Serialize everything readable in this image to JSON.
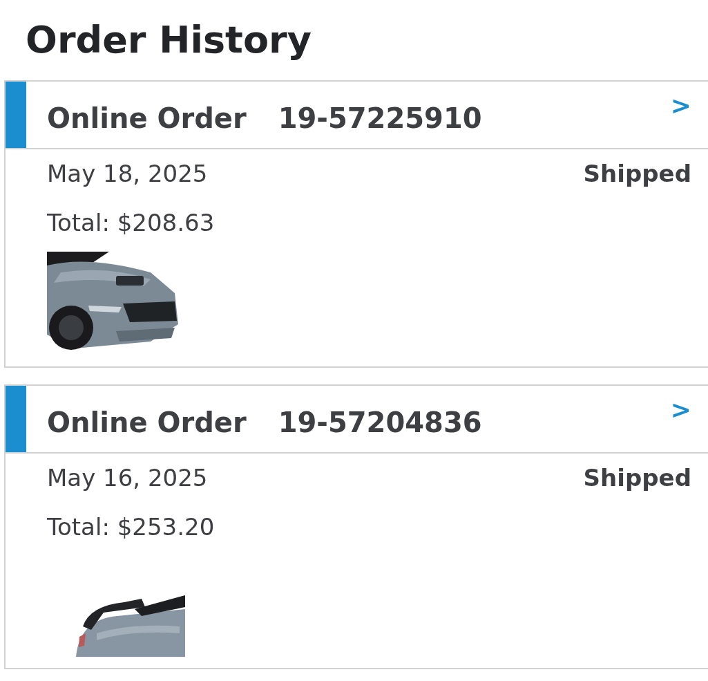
{
  "title": "Order History",
  "orders": [
    {
      "label": "Online Order",
      "number": "19-57225910",
      "chevron": ">",
      "date": "May 18, 2025",
      "status": "Shipped",
      "total": "Total: $208.63"
    },
    {
      "label": "Online Order",
      "number": "19-57204836",
      "chevron": ">",
      "date": "May 16, 2025",
      "status": "Shipped",
      "total": "Total: $253.20"
    }
  ]
}
